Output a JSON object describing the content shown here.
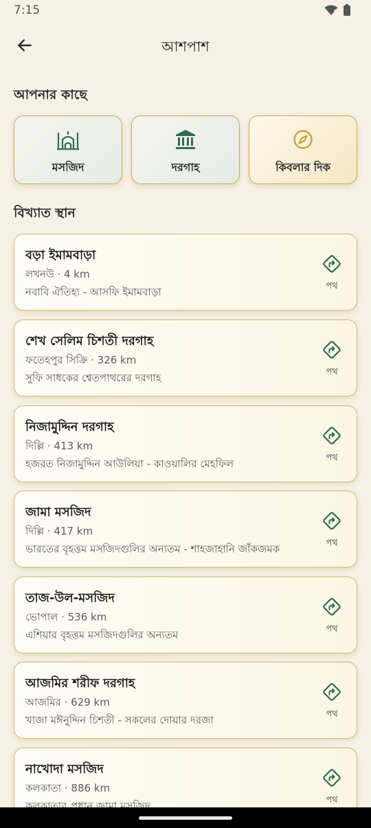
{
  "status_bar": {
    "time": "7:15",
    "icons": [
      "wifi-icon",
      "battery-icon"
    ]
  },
  "app_bar": {
    "title": "আশপাশ",
    "back_icon": "arrow-left-icon"
  },
  "nearby": {
    "title": "আপনার কাছে",
    "tiles": [
      {
        "label": "মসজিদ",
        "icon": "mosque-icon"
      },
      {
        "label": "দরগাহ",
        "icon": "shrine-icon"
      },
      {
        "label": "কিবলার দিক",
        "icon": "compass-icon"
      }
    ]
  },
  "famous": {
    "title": "বিখ্যাত স্থান",
    "direction_label": "পথ",
    "places": [
      {
        "name": "বড়া ইমামবাড়া",
        "sub": "লখনউ · 4 km",
        "desc": "নবাবি ঐতিহ্য - আসফি ইমামবাড়া"
      },
      {
        "name": "শেখ সেলিম চিশতী দরগাহ",
        "sub": "ফতেহপুর সিক্রি · 326 km",
        "desc": "সুফি সাধকের শ্বেতপাথরের দরগাহ"
      },
      {
        "name": "নিজামুদ্দিন দরগাহ",
        "sub": "দিল্লি · 413 km",
        "desc": "হজরত নিজামুদ্দিন আউলিয়া - কাওয়ালির মেহফিল"
      },
      {
        "name": "জামা মসজিদ",
        "sub": "দিল্লি · 417 km",
        "desc": "ভারতের বৃহত্তম মসজিদগুলির অন্যতম - শাহজাহানি জাঁকজমক"
      },
      {
        "name": "তাজ-উল-মসজিদ",
        "sub": "ভোপাল · 536 km",
        "desc": "এশিয়ার বৃহত্তম মসজিদগুলির অন্যতম"
      },
      {
        "name": "আজমির শরীফ দরগাহ",
        "sub": "আজমির · 629 km",
        "desc": "খাজা মঈনুদ্দিন চিশতী - সকলের দোয়ার দরজা"
      },
      {
        "name": "নাখোদা মসজিদ",
        "sub": "কলকাতা · 886 km",
        "desc": "কলকাতার প্রধান জামা মসজিদ"
      }
    ]
  },
  "colors": {
    "background": "#f6f1e6",
    "accent_green": "#2f6b56",
    "accent_gold": "#c9a13a",
    "card_border": "#d2b872"
  }
}
